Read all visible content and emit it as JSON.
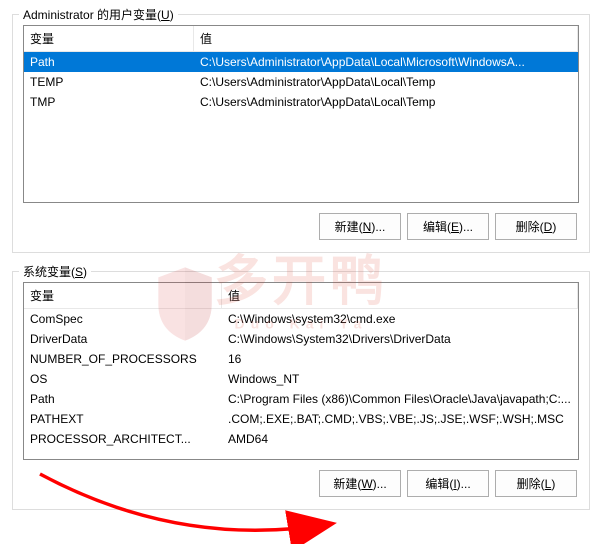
{
  "user_section": {
    "title_prefix": "Administrator 的用户变量(",
    "title_hotkey": "U",
    "title_suffix": ")",
    "columns": {
      "name": "变量",
      "value": "值"
    },
    "rows": [
      {
        "name": "Path",
        "value": "C:\\Users\\Administrator\\AppData\\Local\\Microsoft\\WindowsA...",
        "selected": true
      },
      {
        "name": "TEMP",
        "value": "C:\\Users\\Administrator\\AppData\\Local\\Temp"
      },
      {
        "name": "TMP",
        "value": "C:\\Users\\Administrator\\AppData\\Local\\Temp"
      }
    ],
    "buttons": {
      "new": {
        "pre": "新建(",
        "hot": "N",
        "post": ")..."
      },
      "edit": {
        "pre": "编辑(",
        "hot": "E",
        "post": ")..."
      },
      "delete": {
        "pre": "删除(",
        "hot": "D",
        "post": ")"
      }
    }
  },
  "system_section": {
    "title_prefix": "系统变量(",
    "title_hotkey": "S",
    "title_suffix": ")",
    "columns": {
      "name": "变量",
      "value": "值"
    },
    "rows": [
      {
        "name": "ComSpec",
        "value": "C:\\Windows\\system32\\cmd.exe"
      },
      {
        "name": "DriverData",
        "value": "C:\\Windows\\System32\\Drivers\\DriverData"
      },
      {
        "name": "NUMBER_OF_PROCESSORS",
        "value": "16"
      },
      {
        "name": "OS",
        "value": "Windows_NT"
      },
      {
        "name": "Path",
        "value": "C:\\Program Files (x86)\\Common Files\\Oracle\\Java\\javapath;C:..."
      },
      {
        "name": "PATHEXT",
        "value": ".COM;.EXE;.BAT;.CMD;.VBS;.VBE;.JS;.JSE;.WSF;.WSH;.MSC"
      },
      {
        "name": "PROCESSOR_ARCHITECT...",
        "value": "AMD64"
      }
    ],
    "buttons": {
      "new": {
        "pre": "新建(",
        "hot": "W",
        "post": ")..."
      },
      "edit": {
        "pre": "编辑(",
        "hot": "I",
        "post": ")..."
      },
      "delete": {
        "pre": "删除(",
        "hot": "L",
        "post": ")"
      }
    }
  },
  "watermark": {
    "main": "多开鸭",
    "sub": "Duo Kai Ya"
  },
  "annotation": {
    "arrow_color": "#ff0000"
  }
}
